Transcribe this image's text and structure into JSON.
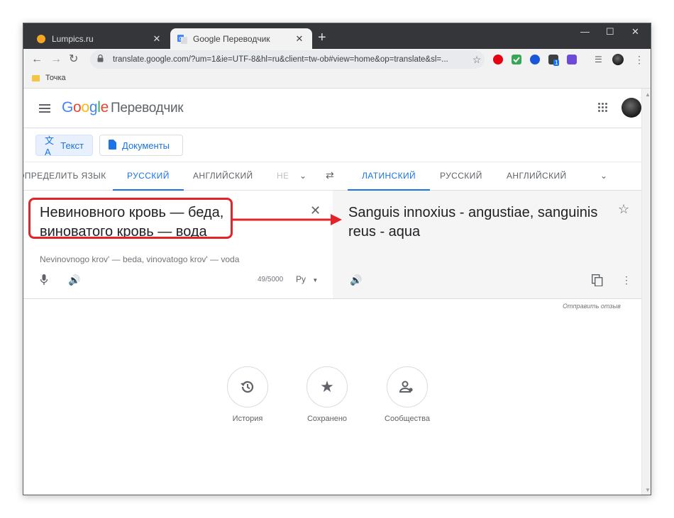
{
  "browser": {
    "tabs": [
      {
        "title": "Lumpics.ru",
        "close": "✕"
      },
      {
        "title": "Google Переводчик",
        "close": "✕"
      }
    ],
    "new_tab": "+",
    "window_controls": {
      "minimize": "—",
      "maximize": "☐",
      "close": "✕"
    },
    "url": "translate.google.com/?um=1&ie=UTF-8&hl=ru&client=tw-ob#view=home&op=translate&sl=...",
    "bookmark": "Точка",
    "icons": [
      "back-arrow-icon",
      "forward-arrow-icon",
      "reload-icon",
      "lock-icon",
      "star-icon",
      "opera-icon",
      "check-icon",
      "globe-icon",
      "extension-icon",
      "menu-dots-icon"
    ],
    "extension_badge": "1"
  },
  "header": {
    "logo_letters": [
      "G",
      "o",
      "o",
      "g",
      "l",
      "e"
    ],
    "logo_colors": [
      "#4285f4",
      "#ea4335",
      "#fbbc05",
      "#4285f4",
      "#34a853",
      "#ea4335"
    ],
    "product": "Переводчик"
  },
  "modes": {
    "text": "Текст",
    "documents": "Документы"
  },
  "source_langs": [
    "ОПРЕДЕЛИТЬ ЯЗЫК",
    "РУССКИЙ",
    "АНГЛИЙСКИЙ",
    "НЕ"
  ],
  "target_langs": [
    "ЛАТИНСКИЙ",
    "РУССКИЙ",
    "АНГЛИЙСКИЙ"
  ],
  "source": {
    "text": "Невиновного кровь — беда, виноватого кровь — вода",
    "transliteration": "Nevinovnogo krov' — beda, vinovatogo krov' — voda",
    "counter": "49/5000",
    "keyboard": "Ру"
  },
  "target": {
    "text": "Sanguis innoxius - angustiae, sanguinis reus - aqua"
  },
  "feedback": "Отправить отзыв",
  "bottom_buttons": [
    {
      "label": "История",
      "icon": "history-icon"
    },
    {
      "label": "Сохранено",
      "icon": "star-icon"
    },
    {
      "label": "Сообщества",
      "icon": "community-icon"
    }
  ],
  "accent_color": "#1a73e8",
  "annotation_color": "#e3232a"
}
